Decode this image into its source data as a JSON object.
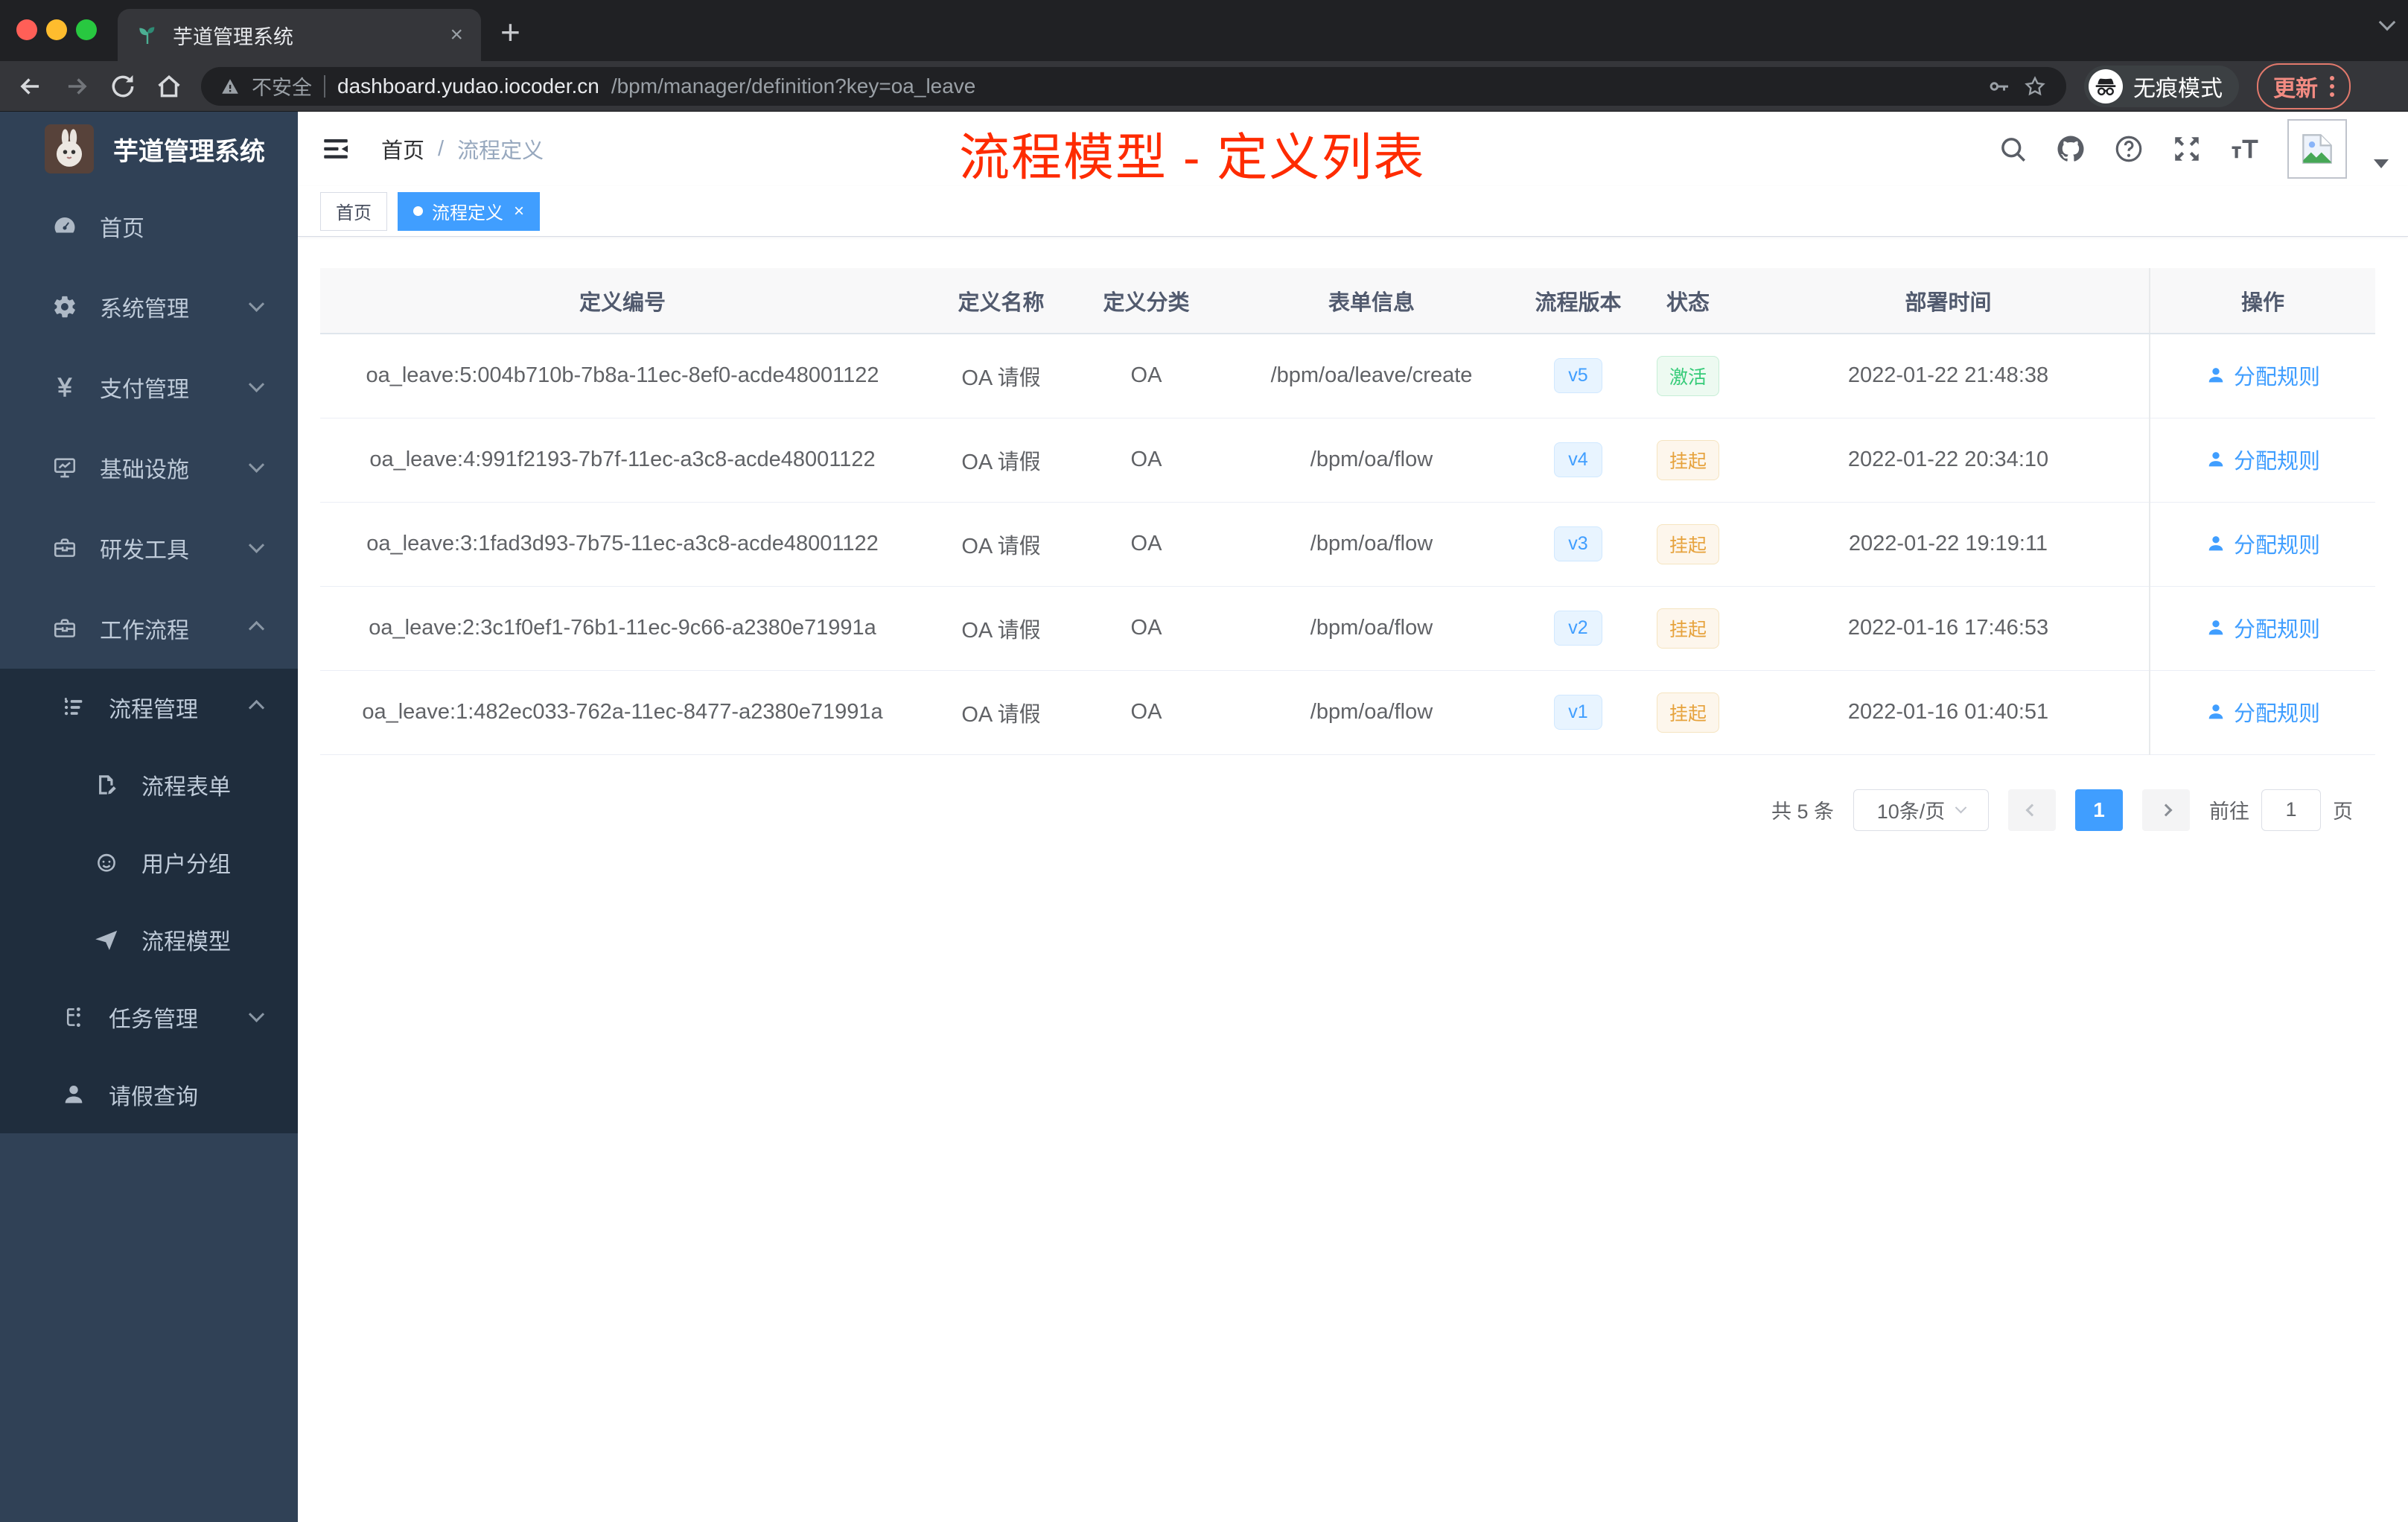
{
  "colors": {
    "accent": "#409eff",
    "success": "#35cb78",
    "warning": "#e6a23c",
    "annotation_red": "#fe2b00",
    "sidebar": "#304156",
    "sidebar_dark": "#1f2d3d"
  },
  "browser": {
    "tab_title": "芋道管理系统",
    "tab_close": "×",
    "new_tab": "+",
    "not_secure": "不安全",
    "url_domain": "dashboard.yudao.iocoder.cn",
    "url_path": "/bpm/manager/definition?key=oa_leave",
    "incognito_label": "无痕模式",
    "update_label": "更新"
  },
  "sidebar": {
    "title": "芋道管理系统",
    "items": [
      {
        "icon": "dashboard-icon",
        "label": "首页"
      },
      {
        "icon": "gear-icon",
        "label": "系统管理",
        "chevron": "down"
      },
      {
        "icon": "yen-icon",
        "label": "支付管理",
        "chevron": "down"
      },
      {
        "icon": "monitor-icon",
        "label": "基础设施",
        "chevron": "down"
      },
      {
        "icon": "toolbox-icon",
        "label": "研发工具",
        "chevron": "down"
      },
      {
        "icon": "briefcase-icon",
        "label": "工作流程",
        "chevron": "up"
      }
    ],
    "submenu": [
      {
        "icon": "list-icon",
        "label": "流程管理",
        "chevron": "up",
        "level": 1
      },
      {
        "icon": "form-icon",
        "label": "流程表单",
        "level": 2
      },
      {
        "icon": "users-icon",
        "label": "用户分组",
        "level": 2
      },
      {
        "icon": "send-icon",
        "label": "流程模型",
        "level": 2
      },
      {
        "icon": "tasks-icon",
        "label": "任务管理",
        "chevron": "down",
        "level": 1
      },
      {
        "icon": "user-icon",
        "label": "请假查询",
        "level": 1
      }
    ]
  },
  "header": {
    "breadcrumb": [
      "首页",
      "流程定义"
    ],
    "separator": "/",
    "annotation": "流程模型 - 定义列表"
  },
  "tags": [
    {
      "label": "首页"
    },
    {
      "label": "流程定义",
      "active": true,
      "close": "×"
    }
  ],
  "table": {
    "columns": [
      "定义编号",
      "定义名称",
      "定义分类",
      "表单信息",
      "流程版本",
      "状态",
      "部署时间",
      "操作"
    ],
    "action_label": "分配规则",
    "rows": [
      {
        "id": "oa_leave:5:004b710b-7b8a-11ec-8ef0-acde48001122",
        "name": "OA 请假",
        "category": "OA",
        "form": "/bpm/oa/leave/create",
        "version": "v5",
        "status": "激活",
        "status_type": "success",
        "time": "2022-01-22 21:48:38",
        "action": "分配规则"
      },
      {
        "id": "oa_leave:4:991f2193-7b7f-11ec-a3c8-acde48001122",
        "name": "OA 请假",
        "category": "OA",
        "form": "/bpm/oa/flow",
        "version": "v4",
        "status": "挂起",
        "status_type": "warning",
        "time": "2022-01-22 20:34:10",
        "action": "分配规则"
      },
      {
        "id": "oa_leave:3:1fad3d93-7b75-11ec-a3c8-acde48001122",
        "name": "OA 请假",
        "category": "OA",
        "form": "/bpm/oa/flow",
        "version": "v3",
        "status": "挂起",
        "status_type": "warning",
        "time": "2022-01-22 19:19:11",
        "action": "分配规则"
      },
      {
        "id": "oa_leave:2:3c1f0ef1-76b1-11ec-9c66-a2380e71991a",
        "name": "OA 请假",
        "category": "OA",
        "form": "/bpm/oa/flow",
        "version": "v2",
        "status": "挂起",
        "status_type": "warning",
        "time": "2022-01-16 17:46:53",
        "action": "分配规则"
      },
      {
        "id": "oa_leave:1:482ec033-762a-11ec-8477-a2380e71991a",
        "name": "OA 请假",
        "category": "OA",
        "form": "/bpm/oa/flow",
        "version": "v1",
        "status": "挂起",
        "status_type": "warning",
        "time": "2022-01-16 01:40:51",
        "action": "分配规则"
      }
    ]
  },
  "pagination": {
    "total": "共 5 条",
    "page_size": "10条/页",
    "page": "1",
    "goto_label": "前往",
    "goto_value": "1",
    "goto_unit": "页"
  }
}
